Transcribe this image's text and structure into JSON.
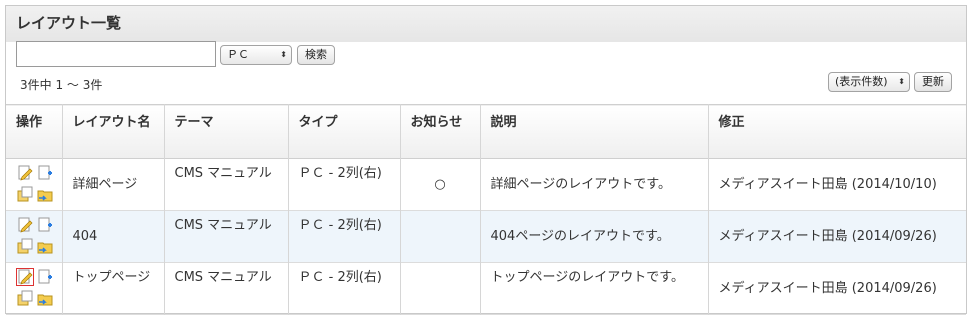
{
  "page": {
    "title": "レイアウト一覧"
  },
  "search": {
    "value": "",
    "device_selected": "ＰＣ",
    "search_button": "検索"
  },
  "result_count": "3件中 1 〜 3件",
  "display_count": {
    "selected": "(表示件数)",
    "update_button": "更新"
  },
  "table": {
    "headers": {
      "ops": "操作",
      "layout_name": "レイアウト名",
      "theme": "テーマ",
      "type": "タイプ",
      "notice": "お知らせ",
      "description": "説明",
      "modified": "修正"
    },
    "rows": [
      {
        "layout_name": "詳細ページ",
        "theme": "CMS マニュアル",
        "type": "ＰＣ - 2列(右)",
        "notice": "○",
        "description": "詳細ページのレイアウトです。",
        "modified": "メディアスイート田島 (2014/10/10)"
      },
      {
        "layout_name": "404",
        "theme": "CMS マニュアル",
        "type": "ＰＣ - 2列(右)",
        "notice": "",
        "description": "404ページのレイアウトです。",
        "modified": "メディアスイート田島 (2014/09/26)"
      },
      {
        "layout_name": "トップページ",
        "theme": "CMS マニュアル",
        "type": "ＰＣ - 2列(右)",
        "notice": "",
        "description": "トップページのレイアウトです。",
        "modified": "メディアスイート田島 (2014/09/26)"
      }
    ]
  },
  "icons": {
    "edit": "edit-icon",
    "add": "add-page-icon",
    "copy": "copy-icon",
    "move": "move-folder-icon"
  },
  "colors": {
    "row_alt": "#eef5fb",
    "header_bg": "#efefef",
    "selected_outline": "#dd3333"
  }
}
